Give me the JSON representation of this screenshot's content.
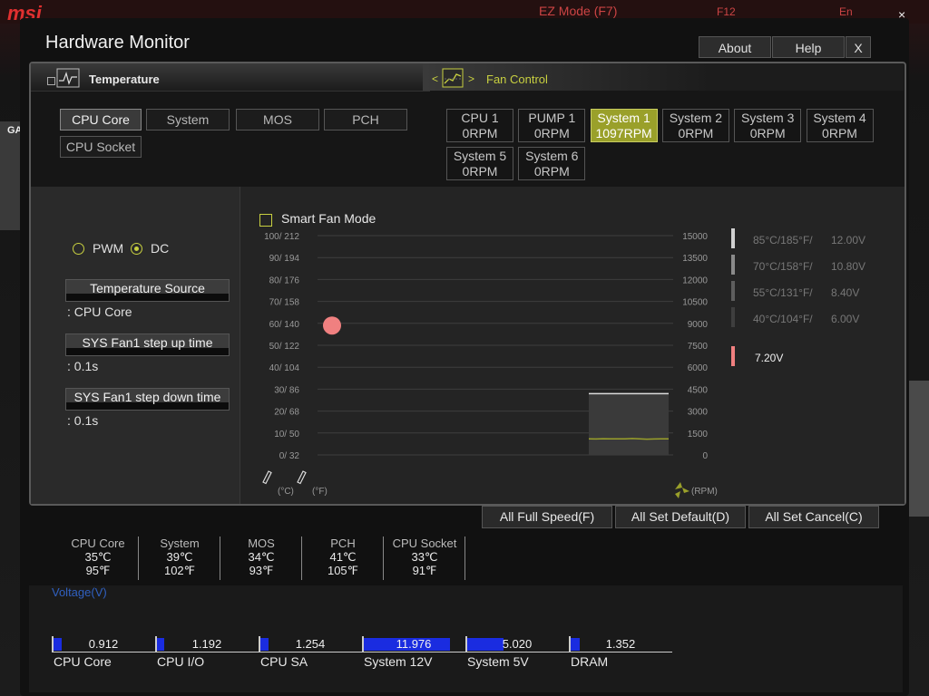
{
  "bios": {
    "logo": "msi",
    "ez_mode": "EZ Mode (F7)",
    "f12": "F12",
    "lang": "En",
    "close": "×",
    "side_tab": "GA"
  },
  "window": {
    "title": "Hardware Monitor",
    "about_label": "About",
    "help_label": "Help",
    "close_label": "X"
  },
  "temperature_section": {
    "title": "Temperature",
    "sources": [
      {
        "label": "CPU Core",
        "active": true
      },
      {
        "label": "System",
        "active": false
      },
      {
        "label": "MOS",
        "active": false
      },
      {
        "label": "PCH",
        "active": false
      },
      {
        "label": "CPU Socket",
        "active": false
      }
    ]
  },
  "fan_section": {
    "title": "Fan Control",
    "prev_arrow": "<",
    "next_arrow": ">",
    "fans": [
      {
        "name": "CPU 1",
        "rpm": "0RPM",
        "active": false
      },
      {
        "name": "PUMP 1",
        "rpm": "0RPM",
        "active": false
      },
      {
        "name": "System 1",
        "rpm": "1097RPM",
        "active": true
      },
      {
        "name": "System 2",
        "rpm": "0RPM",
        "active": false
      },
      {
        "name": "System 3",
        "rpm": "0RPM",
        "active": false
      },
      {
        "name": "System 4",
        "rpm": "0RPM",
        "active": false
      },
      {
        "name": "System 5",
        "rpm": "0RPM",
        "active": false
      },
      {
        "name": "System 6",
        "rpm": "0RPM",
        "active": false
      }
    ]
  },
  "control": {
    "pwm_label": "PWM",
    "dc_label": "DC",
    "mode_selected": "DC",
    "temp_source_label": "Temperature Source",
    "temp_source_value": ": CPU Core",
    "step_up_label": "SYS Fan1 step up time",
    "step_up_value": ": 0.1s",
    "step_down_label": "SYS Fan1 step down time",
    "step_down_value": ": 0.1s"
  },
  "smart_fan": {
    "label": "Smart Fan Mode",
    "checked": false
  },
  "chart": {
    "unit_c": "(°C)",
    "unit_f": "(°F)",
    "unit_rpm": "(RPM)"
  },
  "chart_data": {
    "type": "line",
    "left_ticks": [
      "100/ 212",
      "90/ 194",
      "80/ 176",
      "70/ 158",
      "60/ 140",
      "50/ 122",
      "40/ 104",
      "30/  86",
      "20/  68",
      "10/  50",
      "0/  32"
    ],
    "right_ticks": [
      "15000",
      "13500",
      "12000",
      "10500",
      "9000",
      "7500",
      "6000",
      "4500",
      "3000",
      "1500",
      "0"
    ],
    "ylim_temp_c": [
      0,
      100
    ],
    "ylim_rpm": [
      0,
      15000
    ],
    "current_temp_c": 59,
    "rpm_history_approx": [
      1100,
      1090,
      1110,
      1100,
      1095,
      1105,
      1120,
      1100,
      1080,
      1090,
      1100,
      1105
    ],
    "grid": true
  },
  "voltage_legend": [
    {
      "temp": "85°C/185°F/",
      "volt": "12.00V",
      "active": false
    },
    {
      "temp": "70°C/158°F/",
      "volt": "10.80V",
      "active": false
    },
    {
      "temp": "55°C/131°F/",
      "volt": "8.40V",
      "active": false
    },
    {
      "temp": "40°C/104°F/",
      "volt": "6.00V",
      "active": false
    },
    {
      "temp": "",
      "volt": "7.20V",
      "active": true
    }
  ],
  "buttons": {
    "full_speed": "All Full Speed(F)",
    "set_default": "All Set Default(D)",
    "set_cancel": "All Set Cancel(C)"
  },
  "readouts": [
    {
      "name": "CPU Core",
      "c": "35℃",
      "f": "95℉"
    },
    {
      "name": "System",
      "c": "39℃",
      "f": "102℉"
    },
    {
      "name": "MOS",
      "c": "34℃",
      "f": "93℉"
    },
    {
      "name": "PCH",
      "c": "41℃",
      "f": "105℉"
    },
    {
      "name": "CPU Socket",
      "c": "33℃",
      "f": "91℉"
    }
  ],
  "voltage": {
    "title": "Voltage(V)",
    "items": [
      {
        "name": "CPU Core",
        "value": "0.912",
        "fill": 0.08
      },
      {
        "name": "CPU I/O",
        "value": "1.192",
        "fill": 0.07
      },
      {
        "name": "CPU SA",
        "value": "1.254",
        "fill": 0.08
      },
      {
        "name": "System 12V",
        "value": "11.976",
        "fill": 0.85
      },
      {
        "name": "System 5V",
        "value": "5.020",
        "fill": 0.36
      },
      {
        "name": "DRAM",
        "value": "1.352",
        "fill": 0.09
      }
    ]
  }
}
